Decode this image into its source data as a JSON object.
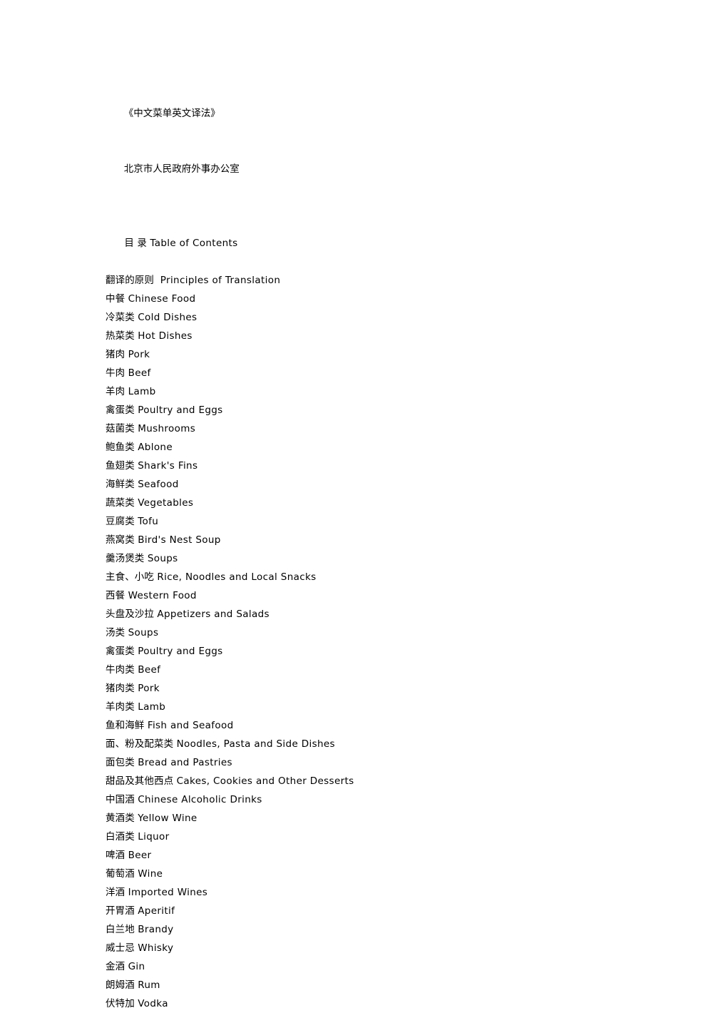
{
  "document": {
    "title_line": "《中文菜单英文译法》",
    "publisher_line": "北京市人民政府外事办公室",
    "toc_heading": {
      "chinese": "目 录",
      "english": "Table of Contents",
      "separator": " "
    },
    "entries": [
      {
        "chinese": "翻译的原则",
        "english": "Principles of Translation",
        "separator": "  "
      },
      {
        "chinese": "中餐",
        "english": "Chinese Food",
        "separator": " "
      },
      {
        "chinese": "冷菜类",
        "english": "Cold Dishes",
        "separator": " "
      },
      {
        "chinese": "热菜类",
        "english": "Hot Dishes",
        "separator": " "
      },
      {
        "chinese": "猪肉",
        "english": "Pork",
        "separator": " "
      },
      {
        "chinese": "牛肉",
        "english": "Beef",
        "separator": " "
      },
      {
        "chinese": "羊肉",
        "english": "Lamb",
        "separator": " "
      },
      {
        "chinese": "禽蛋类",
        "english": "Poultry and Eggs",
        "separator": " "
      },
      {
        "chinese": "菇菌类",
        "english": "Mushrooms",
        "separator": " "
      },
      {
        "chinese": "鲍鱼类",
        "english": "Ablone",
        "separator": " "
      },
      {
        "chinese": "鱼翅类",
        "english": "Shark's Fins",
        "separator": " "
      },
      {
        "chinese": "海鲜类",
        "english": "Seafood",
        "separator": " "
      },
      {
        "chinese": "蔬菜类",
        "english": "Vegetables",
        "separator": " "
      },
      {
        "chinese": "豆腐类",
        "english": "Tofu",
        "separator": " "
      },
      {
        "chinese": "燕窝类",
        "english": "Bird's Nest Soup",
        "separator": " "
      },
      {
        "chinese": "羹汤煲类",
        "english": "Soups",
        "separator": " "
      },
      {
        "chinese": "主食、小吃",
        "english": "Rice, Noodles and Local Snacks",
        "separator": " "
      },
      {
        "chinese": "西餐",
        "english": "Western Food",
        "separator": " "
      },
      {
        "chinese": "头盘及沙拉",
        "english": "Appetizers and Salads",
        "separator": " "
      },
      {
        "chinese": "汤类",
        "english": "Soups",
        "separator": " "
      },
      {
        "chinese": "禽蛋类",
        "english": "Poultry and Eggs",
        "separator": " "
      },
      {
        "chinese": "牛肉类",
        "english": "Beef",
        "separator": " "
      },
      {
        "chinese": "猪肉类",
        "english": "Pork",
        "separator": " "
      },
      {
        "chinese": "羊肉类",
        "english": "Lamb",
        "separator": " "
      },
      {
        "chinese": "鱼和海鲜",
        "english": "Fish and Seafood",
        "separator": " "
      },
      {
        "chinese": "面、粉及配菜类",
        "english": "Noodles, Pasta and Side Dishes",
        "separator": " "
      },
      {
        "chinese": "面包类",
        "english": "Bread and Pastries",
        "separator": " "
      },
      {
        "chinese": "甜品及其他西点",
        "english": "Cakes, Cookies and Other Desserts",
        "separator": " "
      },
      {
        "chinese": "中国酒",
        "english": "Chinese Alcoholic Drinks",
        "separator": " "
      },
      {
        "chinese": "黄酒类",
        "english": "Yellow Wine",
        "separator": " "
      },
      {
        "chinese": "白酒类",
        "english": "Liquor",
        "separator": " "
      },
      {
        "chinese": "啤酒",
        "english": "Beer",
        "separator": " "
      },
      {
        "chinese": "葡萄酒",
        "english": "Wine",
        "separator": " "
      },
      {
        "chinese": "洋酒",
        "english": "Imported Wines",
        "separator": " "
      },
      {
        "chinese": "开胃酒",
        "english": "Aperitif",
        "separator": " "
      },
      {
        "chinese": "白兰地",
        "english": "Brandy",
        "separator": " "
      },
      {
        "chinese": "威士忌",
        "english": "Whisky",
        "separator": " "
      },
      {
        "chinese": "金酒",
        "english": "Gin",
        "separator": " "
      },
      {
        "chinese": "朗姆酒",
        "english": "Rum",
        "separator": " "
      },
      {
        "chinese": "伏特加",
        "english": "Vodka",
        "separator": " "
      }
    ]
  },
  "colors": {
    "page_background": "#ffffff",
    "text": "#000000"
  }
}
